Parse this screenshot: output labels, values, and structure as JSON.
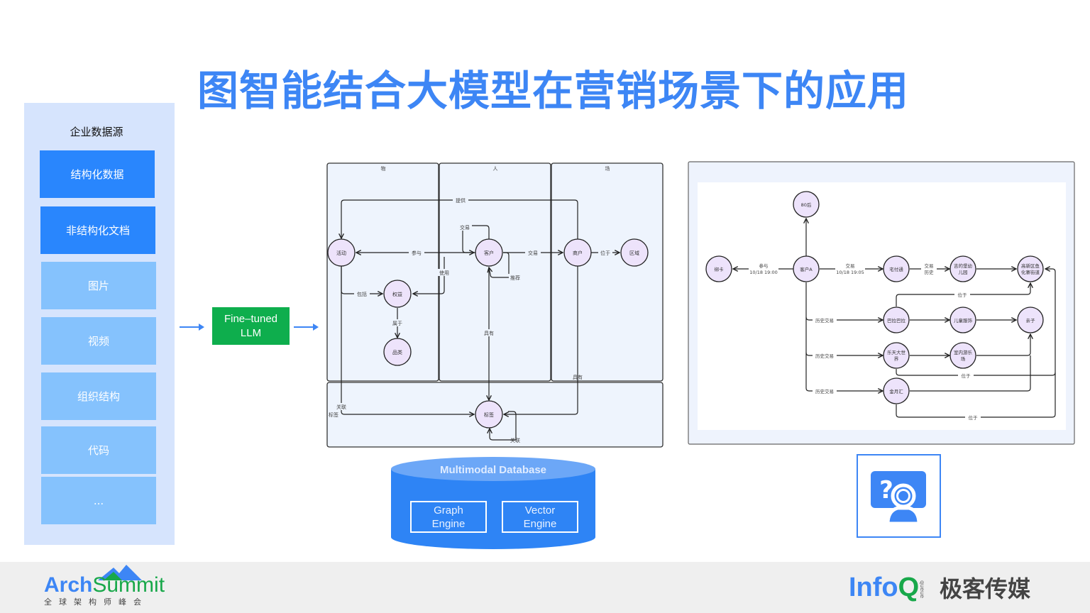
{
  "title": "图智能结合大模型在营销场景下的应用",
  "sources": {
    "title": "企业数据源",
    "items": [
      {
        "label": "结构化数据",
        "style": "dark"
      },
      {
        "label": "非结构化文档",
        "style": "dark"
      },
      {
        "label": "图片",
        "style": "light"
      },
      {
        "label": "视频",
        "style": "light"
      },
      {
        "label": "组织结构",
        "style": "light"
      },
      {
        "label": "代码",
        "style": "light"
      },
      {
        "label": "...",
        "style": "light"
      }
    ]
  },
  "llm": {
    "line1": "Fine–tuned",
    "line2": "LLM"
  },
  "schema_graph": {
    "lanes": [
      "物",
      "人",
      "场"
    ],
    "nodes": {
      "activity": "活动",
      "benefit": "权益",
      "category": "品类",
      "customer": "客户",
      "merchant": "商户",
      "region": "区域",
      "tag": "标签"
    },
    "edges": {
      "provide": "提供",
      "participate": "参与",
      "include": "包括",
      "use": "使用",
      "belong": "属于",
      "trade_self": "交易",
      "trade": "交易",
      "recommend": "推荐",
      "located": "位于",
      "has_left": "具有",
      "has_right": "具有",
      "relate_left": "关联",
      "tag_left": "标签",
      "relate_self": "关联"
    }
  },
  "database": {
    "title": "Multimodal Database",
    "engines": [
      {
        "line1": "Graph",
        "line2": "Engine"
      },
      {
        "line1": "Vector",
        "line2": "Engine"
      }
    ]
  },
  "instance_graph": {
    "nodes": {
      "post80": "80后",
      "bindcard": "绑卡",
      "customerA": "客户A",
      "zhaifutong": "宅付通",
      "kindergarten_1": "吉的堡幼",
      "kindergarten_2": "儿园",
      "district_1": "高新区鱼",
      "district_2": "化寨街道",
      "balabala": "巴拉巴拉",
      "kidswear": "儿童服饰",
      "parentchild": "亲子",
      "lotte_1": "乐天大世",
      "lotte_2": "界",
      "indoorpark_1": "室内游乐",
      "indoorpark_2": "场",
      "jinyuehui": "金月汇"
    },
    "edges": {
      "participate": "参与",
      "participate_time": "10/18 19:00",
      "trade": "交易",
      "trade_time": "10/18 19:05",
      "trade_hist_1": "交易",
      "trade_hist_2": "历史",
      "history1": "历史交易",
      "history2": "历史交易",
      "history3": "历史交易",
      "located1": "位于",
      "located2": "位于",
      "located3": "位于"
    }
  },
  "qa_icon": "question-user-icon",
  "footer": {
    "arch_a": "Arch",
    "arch_s": "Summit",
    "arch_sub": "全球架构师峰会",
    "infoq_i": "Info",
    "infoq_q": "Q",
    "queue": "queue",
    "infoq_cn": "极客传媒"
  },
  "colors": {
    "accent": "#3d86f5",
    "dark_block": "#2986fd",
    "light_block": "#85c2fd",
    "panel": "#d6e4fd",
    "llm": "#0eae4d",
    "node_fill": "#ede3fb",
    "lane_fill": "#eef4fd"
  }
}
